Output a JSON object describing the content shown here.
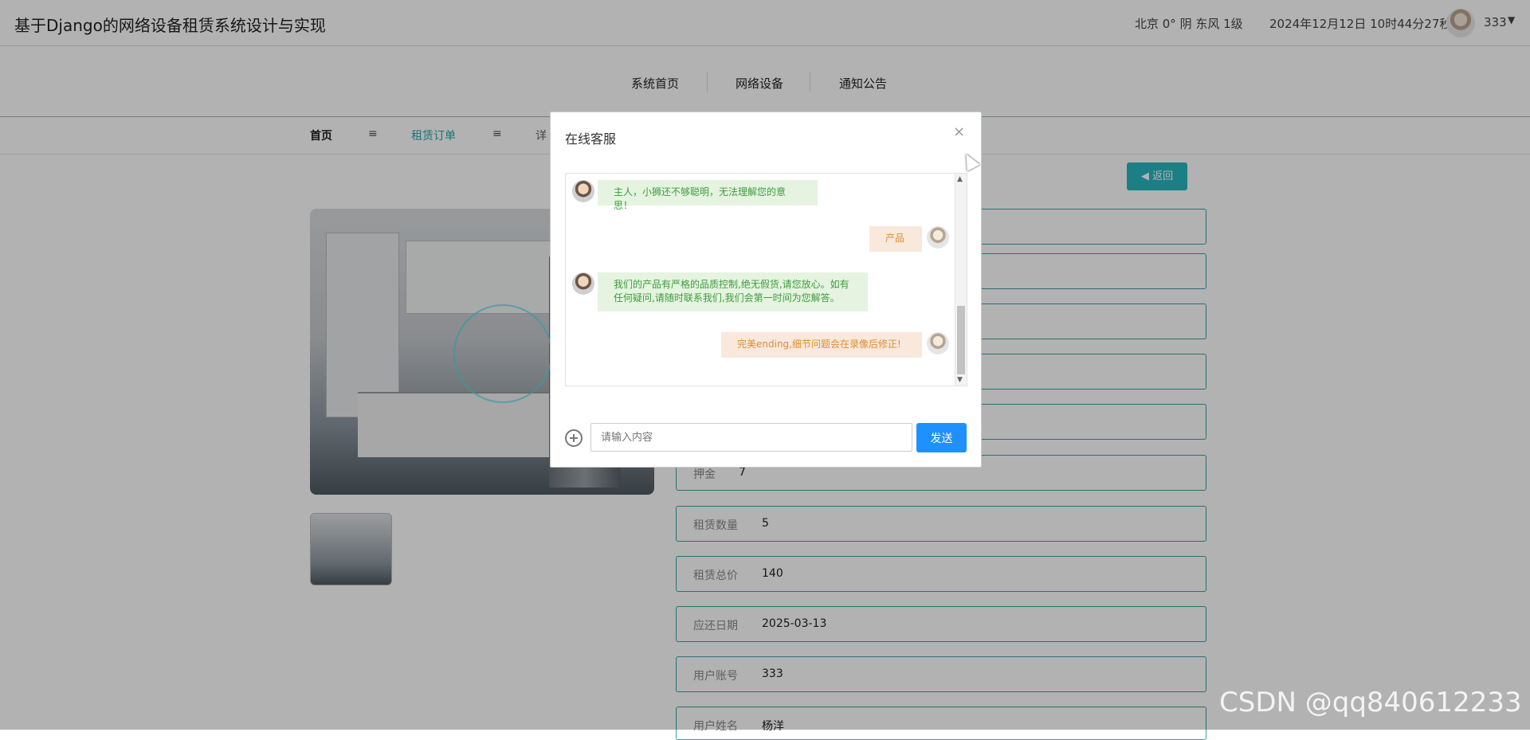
{
  "header": {
    "site_title": "基于Django的网络设备租赁系统设计与实现",
    "weather": "北京 0° 阴 东风 1级",
    "datetime": "2024年12月12日 10时44分27秒",
    "username": "333"
  },
  "nav": {
    "items": [
      "系统首页",
      "网络设备",
      "通知公告"
    ]
  },
  "breadcrumb": {
    "home": "首页",
    "sep": "≡",
    "current": "租赁订单",
    "detail_partial": "详"
  },
  "back_button": "返回",
  "detail_fields": [
    {
      "label": "押金",
      "value": "7"
    },
    {
      "label": "租赁数量",
      "value": "5"
    },
    {
      "label": "租赁总价",
      "value": "140"
    },
    {
      "label": "应还日期",
      "value": "2025-03-13"
    },
    {
      "label": "用户账号",
      "value": "333"
    },
    {
      "label": "用户姓名",
      "value": "杨洋"
    }
  ],
  "chat_dialog": {
    "title": "在线客服",
    "close_symbol": "×",
    "messages": [
      {
        "side": "left",
        "lines": [
          "主人，小狮还不够聪明，无法理解您的意思！"
        ]
      },
      {
        "side": "right",
        "lines": [
          "产品"
        ]
      },
      {
        "side": "left",
        "lines": [
          "我们的产品有严格的品质控制,绝无假货,请您放心。如有",
          "任何疑问,请随时联系我们,我们会第一时间为您解答。"
        ]
      },
      {
        "side": "right",
        "lines": [
          "完美ending,细节问题会在录像后修正!"
        ]
      }
    ],
    "input_placeholder": "请输入内容",
    "send_label": "发送"
  },
  "watermark": "CSDN @qq840612233",
  "colors": {
    "accent": "#28b7bf",
    "field_border": "#3aa2a5",
    "bot_bubble": "#e5f3e0",
    "user_bubble": "#f9e8dc",
    "send_button": "#1e90ff"
  }
}
